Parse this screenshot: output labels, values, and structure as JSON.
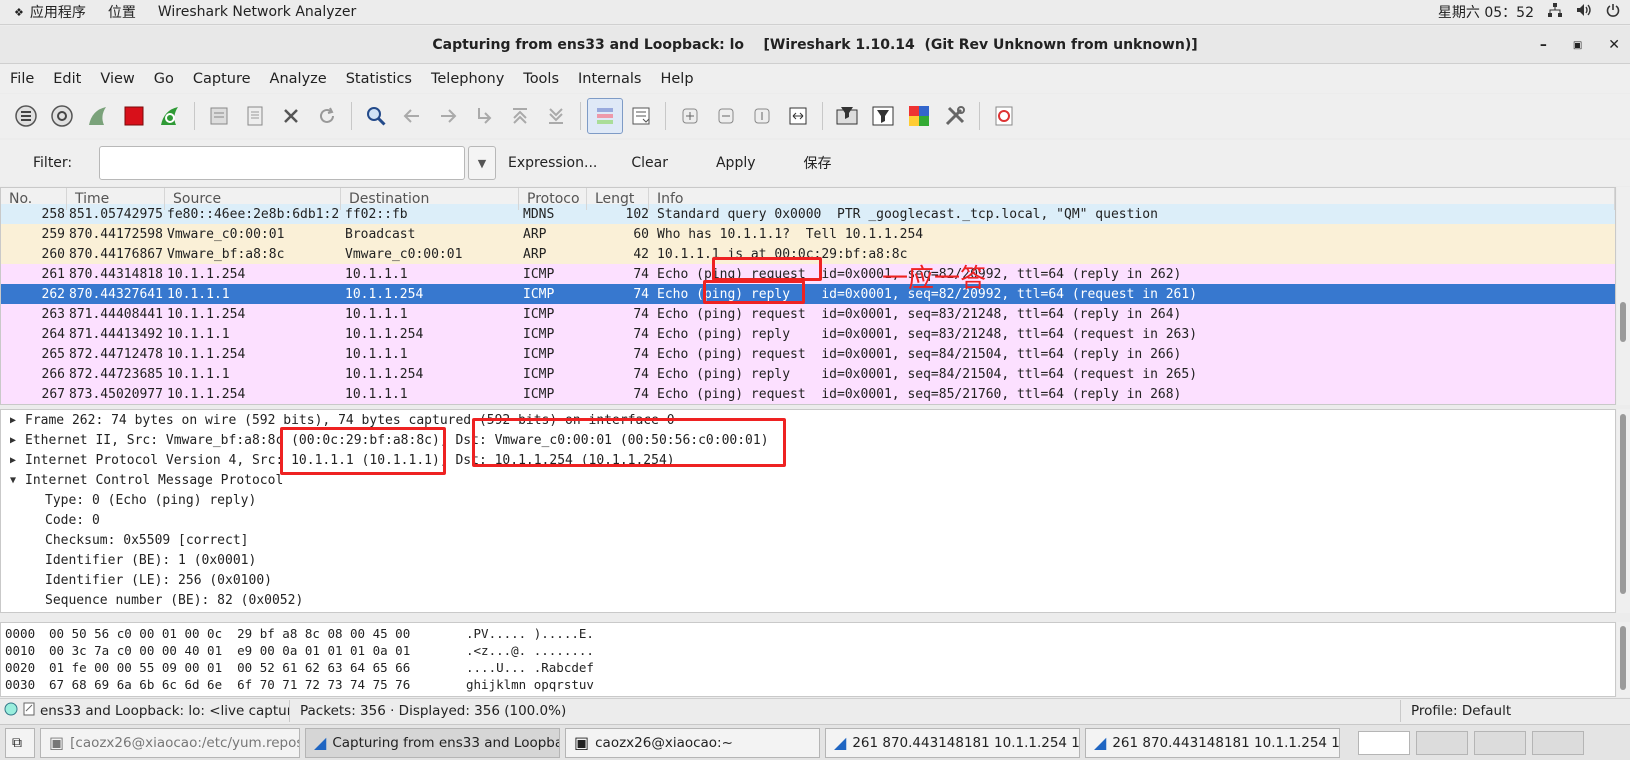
{
  "topbar": {
    "apps": "应用程序",
    "places": "位置",
    "window": "Wireshark Network Analyzer",
    "clock": "星期六 05：52"
  },
  "titlebar": {
    "title": "Capturing from ens33 and Loopback: lo    [Wireshark 1.10.14  (Git Rev Unknown from unknown)]"
  },
  "menu": [
    "File",
    "Edit",
    "View",
    "Go",
    "Capture",
    "Analyze",
    "Statistics",
    "Telephony",
    "Tools",
    "Internals",
    "Help"
  ],
  "filter": {
    "label": "Filter:",
    "value": "",
    "expression": "Expression...",
    "clear": "Clear",
    "apply": "Apply",
    "save": "保存"
  },
  "packet_list": {
    "columns": [
      "No.",
      "Time",
      "Source",
      "Destination",
      "Protoco",
      "Lengt",
      "Info"
    ],
    "rows": [
      {
        "no": "258",
        "time": "851.057429755",
        "src": "fe80::46ee:2e8b:6db1:2",
        "dst": "ff02::fb",
        "proto": "MDNS",
        "len": "102",
        "info": "Standard query 0x0000  PTR _googlecast._tcp.local, \"QM\" question",
        "color": "#dceef9"
      },
      {
        "no": "259",
        "time": "870.441725985",
        "src": "Vmware_c0:00:01",
        "dst": "Broadcast",
        "proto": "ARP",
        "len": "60",
        "info": "Who has 10.1.1.1?  Tell 10.1.1.254",
        "color": "#faf0d7"
      },
      {
        "no": "260",
        "time": "870.441768675",
        "src": "Vmware_bf:a8:8c",
        "dst": "Vmware_c0:00:01",
        "proto": "ARP",
        "len": "42",
        "info": "10.1.1.1 is at 00:0c:29:bf:a8:8c",
        "color": "#faf0d7"
      },
      {
        "no": "261",
        "time": "870.443148181",
        "src": "10.1.1.254",
        "dst": "10.1.1.1",
        "proto": "ICMP",
        "len": "74",
        "info": "Echo (ping) request  id=0x0001, seq=82/20992, ttl=64 (reply in 262)",
        "color": "#fce0ff"
      },
      {
        "no": "262",
        "time": "870.443276412",
        "src": "10.1.1.1",
        "dst": "10.1.1.254",
        "proto": "ICMP",
        "len": "74",
        "info": "Echo (ping) reply    id=0x0001, seq=82/20992, ttl=64 (request in 261)",
        "color": "#3778cf"
      },
      {
        "no": "263",
        "time": "871.444084415",
        "src": "10.1.1.254",
        "dst": "10.1.1.1",
        "proto": "ICMP",
        "len": "74",
        "info": "Echo (ping) request  id=0x0001, seq=83/21248, ttl=64 (reply in 264)",
        "color": "#fce0ff"
      },
      {
        "no": "264",
        "time": "871.444134920",
        "src": "10.1.1.1",
        "dst": "10.1.1.254",
        "proto": "ICMP",
        "len": "74",
        "info": "Echo (ping) reply    id=0x0001, seq=83/21248, ttl=64 (request in 263)",
        "color": "#fce0ff"
      },
      {
        "no": "265",
        "time": "872.447124786",
        "src": "10.1.1.254",
        "dst": "10.1.1.1",
        "proto": "ICMP",
        "len": "74",
        "info": "Echo (ping) request  id=0x0001, seq=84/21504, ttl=64 (reply in 266)",
        "color": "#fce0ff"
      },
      {
        "no": "266",
        "time": "872.447236856",
        "src": "10.1.1.1",
        "dst": "10.1.1.254",
        "proto": "ICMP",
        "len": "74",
        "info": "Echo (ping) reply    id=0x0001, seq=84/21504, ttl=64 (request in 265)",
        "color": "#fce0ff"
      },
      {
        "no": "267",
        "time": "873.450209772",
        "src": "10.1.1.254",
        "dst": "10.1.1.1",
        "proto": "ICMP",
        "len": "74",
        "info": "Echo (ping) request  id=0x0001, seq=85/21760, ttl=64 (reply in 268)",
        "color": "#fce0ff"
      }
    ]
  },
  "details": {
    "frame": "Frame 262: 74 bytes on wire (592 bits), 74 bytes captured (592 bits) on interface 0",
    "ethernet": "Ethernet II, Src: Vmware_bf:a8:8c (00:0c:29:bf:a8:8c), Dst: Vmware_c0:00:01 (00:50:56:c0:00:01)",
    "ip": "Internet Protocol Version 4, Src: 10.1.1.1 (10.1.1.1), Dst: 10.1.1.254 (10.1.1.254)",
    "icmp": "Internet Control Message Protocol",
    "icmp_fields": [
      "Type: 0 (Echo (ping) reply)",
      "Code: 0",
      "Checksum: 0x5509 [correct]",
      "Identifier (BE): 1 (0x0001)",
      "Identifier (LE): 256 (0x0100)",
      "Sequence number (BE): 82 (0x0052)"
    ]
  },
  "hex": [
    {
      "off": "0000",
      "bytes": "00 50 56 c0 00 01 00 0c  29 bf a8 8c 08 00 45 00",
      "ascii": ".PV..... ).....E."
    },
    {
      "off": "0010",
      "bytes": "00 3c 7a c0 00 00 40 01  e9 00 0a 01 01 01 0a 01",
      "ascii": ".<z...@. ........"
    },
    {
      "off": "0020",
      "bytes": "01 fe 00 00 55 09 00 01  00 52 61 62 63 64 65 66",
      "ascii": "....U... .Rabcdef"
    },
    {
      "off": "0030",
      "bytes": "67 68 69 6a 6b 6c 6d 6e  6f 70 71 72 73 74 75 76",
      "ascii": "ghijklmn opqrstuv"
    }
  ],
  "status": {
    "capture": "ens33 and Loopback: lo: <live captur…",
    "packets": "Packets: 356 · Displayed: 356 (100.0%)",
    "profile": "Profile: Default"
  },
  "annotation": {
    "text": "一应一答",
    "color": "#ee2222"
  },
  "taskbar": [
    "[caozx26@xiaocao:/etc/yum.repos.d]",
    "Capturing from ens33 and Loopbac…",
    "caozx26@xiaocao:~",
    "261 870.443148181 10.1.1.254 1…",
    "261 870.443148181 10.1.1.254 1…"
  ],
  "icons": {
    "toolbar": [
      "interfaces-icon",
      "options-icon",
      "start-capture-icon",
      "stop-capture-icon",
      "restart-capture-icon",
      "open-file-icon",
      "save-file-icon",
      "close-file-icon",
      "reload-icon",
      "find-icon",
      "go-back-icon",
      "go-forward-icon",
      "go-to-packet-icon",
      "first-packet-icon",
      "last-packet-icon",
      "colorize-icon",
      "autoscroll-icon",
      "zoom-in-icon",
      "zoom-out-icon",
      "normal-size-icon",
      "resize-columns-icon",
      "capture-filters-icon",
      "display-filters-icon",
      "coloring-rules-icon",
      "preferences-icon",
      "help-icon"
    ]
  }
}
